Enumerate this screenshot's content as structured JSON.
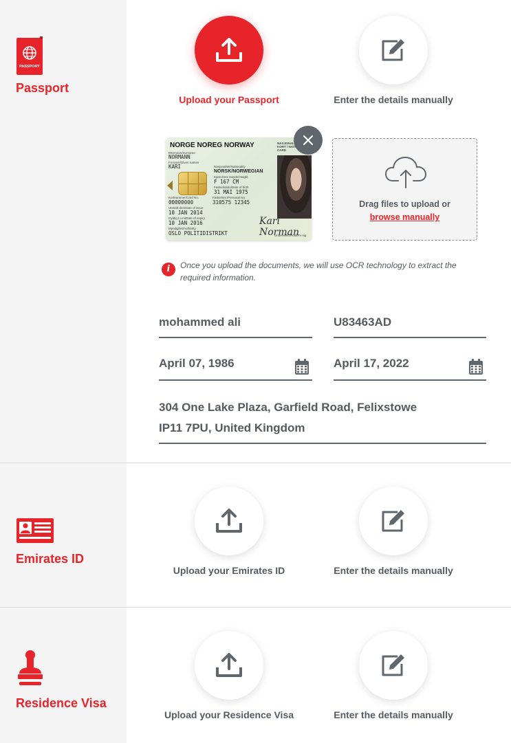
{
  "passport": {
    "label": "Passport",
    "upload_label": "Upload your Passport",
    "manual_label": "Enter the details manually",
    "id_card": {
      "header": "NORGE NOREG NORWAY",
      "national_id": "NASJONALT ID-KORT / NATIONAL ID CARD",
      "surname_label": "Etternavn/Surname",
      "surname": "NORMANN",
      "given_label": "Fornavn/Given names",
      "given": "KARI",
      "nationality_label": "Nasjonalitet/Nationality",
      "nationality": "NORSK/NORWEGIAN",
      "sex_height_label": "Kjønn/Sex   Høyde/Height",
      "sex_height": "F    167 CM",
      "dob_label": "Fødselsdato/Date of birth",
      "dob": "31 MAI 1975",
      "card_label": "Kortnummer/Card No.",
      "card_no": "00000000",
      "personal_label": "Fødselsnr./Personal No.",
      "personal_no": "310575 12345",
      "issue_label": "Utstedt den/Date of issue",
      "issue_date": "10 JAN 2014",
      "expiry_label": "Gyldig t.o.m/Date of expiry",
      "expiry_date": "10 JAN 2016",
      "authority_label": "Myndighet/Authority",
      "authority": "OSLO POLITIDISTRIKT",
      "signature": "Kari Norman",
      "signature_label": "Underskrift/Holder's sig"
    },
    "dropzone": {
      "text": "Drag files to upload or",
      "link": "browse manually"
    },
    "info": "Once you upload the documents, we will use OCR technology to extract the required information.",
    "fields": {
      "name": "mohammed ali",
      "passport_no": "U83463AD",
      "issue_date": "April 07, 1986",
      "expiry_date": "April 17, 2022",
      "address_line1": "304 One Lake Plaza, Garfield Road, Felixstowe",
      "address_line2": "IP11 7PU, United Kingdom"
    }
  },
  "emirates_id": {
    "label": "Emirates ID",
    "upload_label": "Upload your Emirates ID",
    "manual_label": "Enter the details manually"
  },
  "residence_visa": {
    "label": "Residence Visa",
    "upload_label": "Upload your Residence Visa",
    "manual_label": "Enter the details manually"
  },
  "colors": {
    "accent": "#e8242b",
    "text": "#555b60",
    "sidebar": "#f4f4f4"
  }
}
